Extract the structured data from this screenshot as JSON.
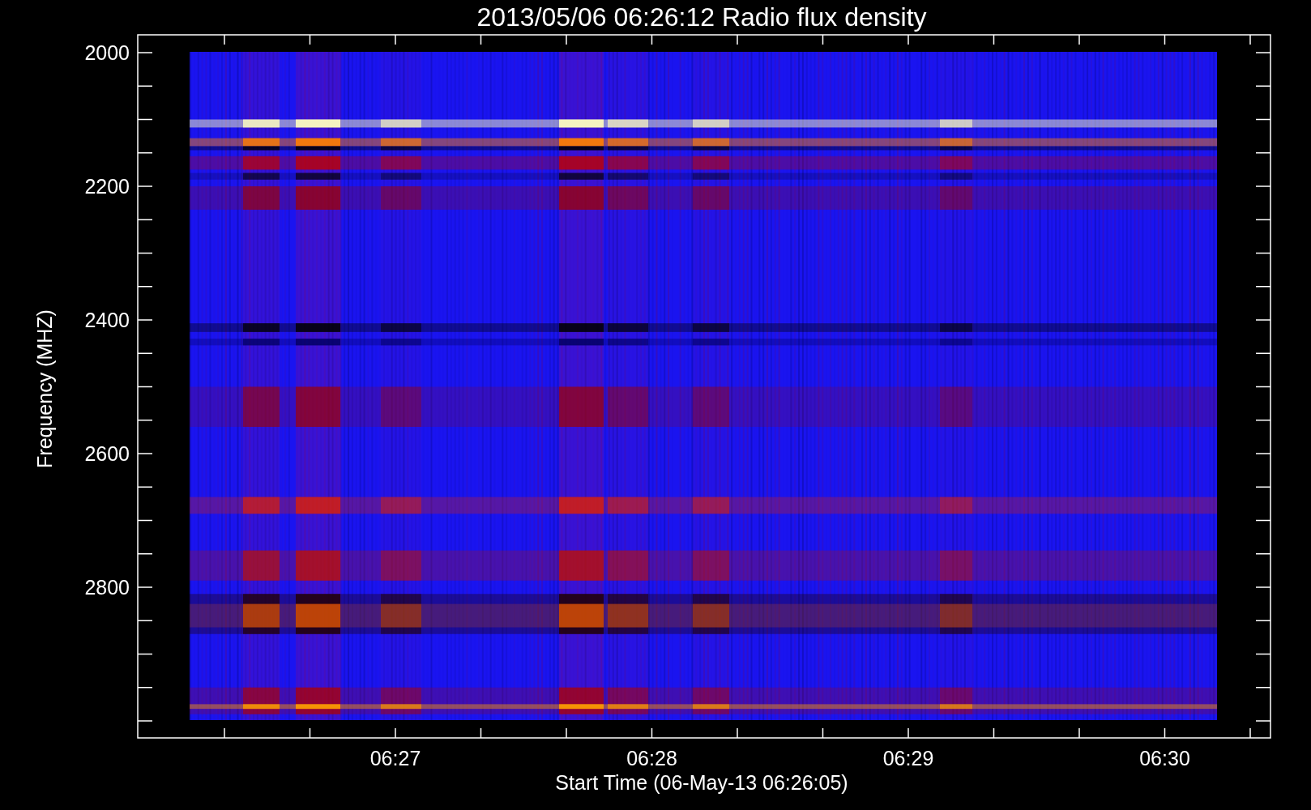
{
  "title": "2013/05/06 06:26:12 Radio flux density",
  "y_axis": {
    "label": "Frequency (MHZ)",
    "tick_labels": [
      "2000",
      "2200",
      "2400",
      "2600",
      "2800"
    ]
  },
  "x_axis": {
    "label": "Start Time (06-May-13 06:26:05)",
    "tick_labels": [
      "06:27",
      "06:28",
      "06:29",
      "06:30"
    ]
  }
}
